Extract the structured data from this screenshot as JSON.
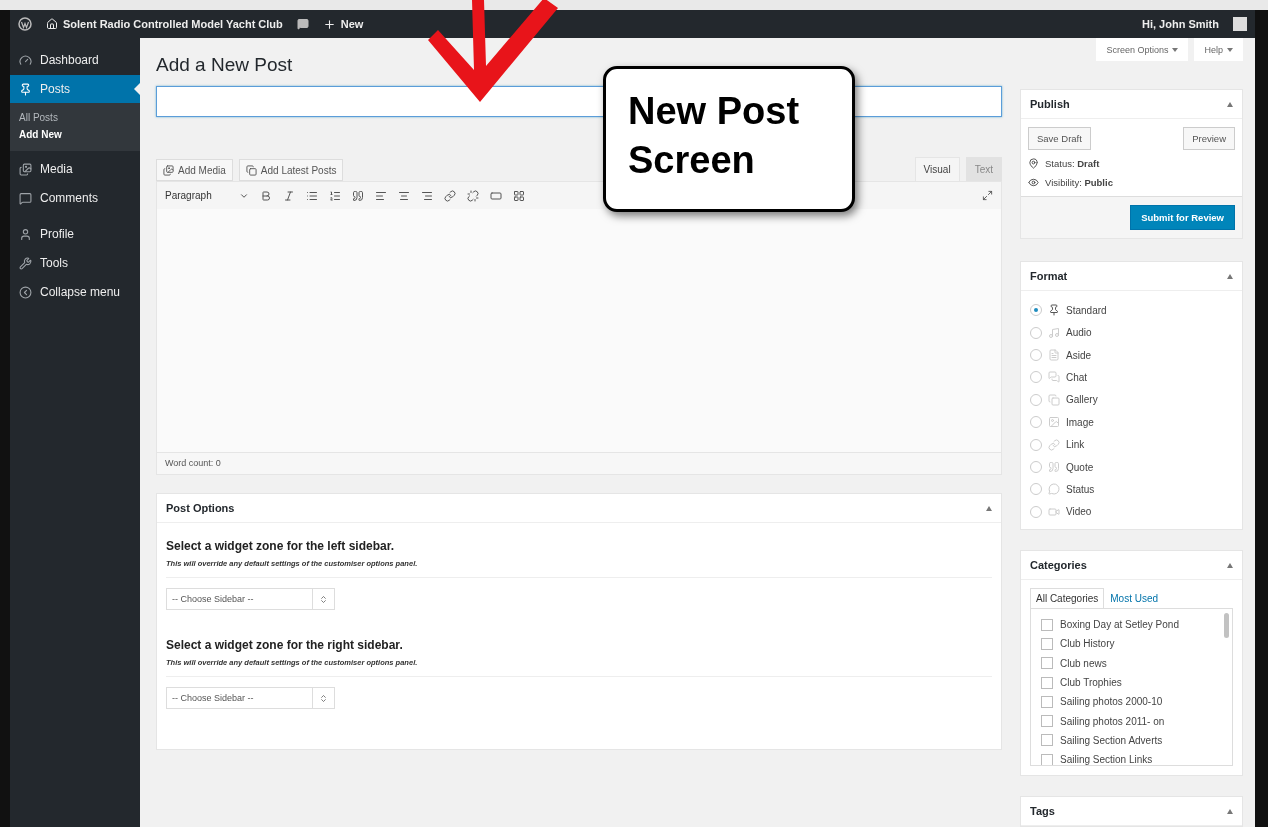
{
  "admin_bar": {
    "site_name": "Solent Radio Controlled Model Yacht Club",
    "new_label": "New",
    "greeting": "Hi, John Smith"
  },
  "menu": [
    {
      "label": "Dashboard",
      "kind": "dashboard",
      "selected": false
    },
    {
      "label": "Posts",
      "kind": "posts",
      "selected": true,
      "children": [
        {
          "label": "All Posts",
          "selected": false
        },
        {
          "label": "Add New",
          "selected": true
        }
      ]
    },
    {
      "label": "Media",
      "kind": "media",
      "selected": false
    },
    {
      "label": "Comments",
      "kind": "comments",
      "selected": false
    },
    {
      "label": "Profile",
      "kind": "profile",
      "selected": false
    },
    {
      "label": "Tools",
      "kind": "tools",
      "selected": false
    },
    {
      "label": "Collapse menu",
      "kind": "collapse",
      "selected": false
    }
  ],
  "screen_buttons": [
    "Screen Options",
    "Help"
  ],
  "page_title": "Add a New Post",
  "media_buttons": [
    {
      "label": "Add Media",
      "kind": "media"
    },
    {
      "label": "Add Latest Posts",
      "kind": "posts"
    }
  ],
  "editor_tabs": [
    {
      "label": "Visual",
      "selected": true
    },
    {
      "label": "Text",
      "selected": false
    }
  ],
  "format_select": "Paragraph",
  "word_count": "Word count: 0",
  "post_options": {
    "title": "Post Options",
    "zones": [
      {
        "heading": "Select a widget zone for the left sidebar.",
        "note": "This will override any default settings of the customiser options panel.",
        "select": "-- Choose Sidebar --"
      },
      {
        "heading": "Select a widget zone for the right sidebar.",
        "note": "This will override any default settings of the customiser options panel.",
        "select": "-- Choose Sidebar --"
      }
    ]
  },
  "publish": {
    "title": "Publish",
    "save_draft": "Save Draft",
    "preview": "Preview",
    "status": "Status: **Draft**",
    "visibility": "Visibility: **Public**",
    "submit": "Submit for Review"
  },
  "format": {
    "title": "Format",
    "options": [
      {
        "label": "Standard",
        "kind": "standard",
        "selected": true
      },
      {
        "label": "Audio",
        "kind": "audio",
        "selected": false
      },
      {
        "label": "Aside",
        "kind": "aside",
        "selected": false
      },
      {
        "label": "Chat",
        "kind": "chat",
        "selected": false
      },
      {
        "label": "Gallery",
        "kind": "gallery",
        "selected": false
      },
      {
        "label": "Image",
        "kind": "image",
        "selected": false
      },
      {
        "label": "Link",
        "kind": "link",
        "selected": false
      },
      {
        "label": "Quote",
        "kind": "quote",
        "selected": false
      },
      {
        "label": "Status",
        "kind": "status",
        "selected": false
      },
      {
        "label": "Video",
        "kind": "video",
        "selected": false
      }
    ]
  },
  "categories": {
    "title": "Categories",
    "tabs": [
      {
        "label": "All Categories",
        "selected": true
      },
      {
        "label": "Most Used",
        "selected": false
      }
    ],
    "items": [
      {
        "label": "Boxing Day at Setley Pond",
        "checked": false
      },
      {
        "label": "Club History",
        "checked": false
      },
      {
        "label": "Club news",
        "checked": false
      },
      {
        "label": "Club Trophies",
        "checked": false
      },
      {
        "label": "Sailing photos 2000-10",
        "checked": false
      },
      {
        "label": "Sailing photos 2011- on",
        "checked": false
      },
      {
        "label": "Sailing Section Adverts",
        "checked": false
      },
      {
        "label": "Sailing Section Links",
        "checked": false
      }
    ]
  },
  "tags": {
    "title": "Tags"
  },
  "callout": {
    "lines": [
      "New Post",
      "Screen"
    ]
  }
}
